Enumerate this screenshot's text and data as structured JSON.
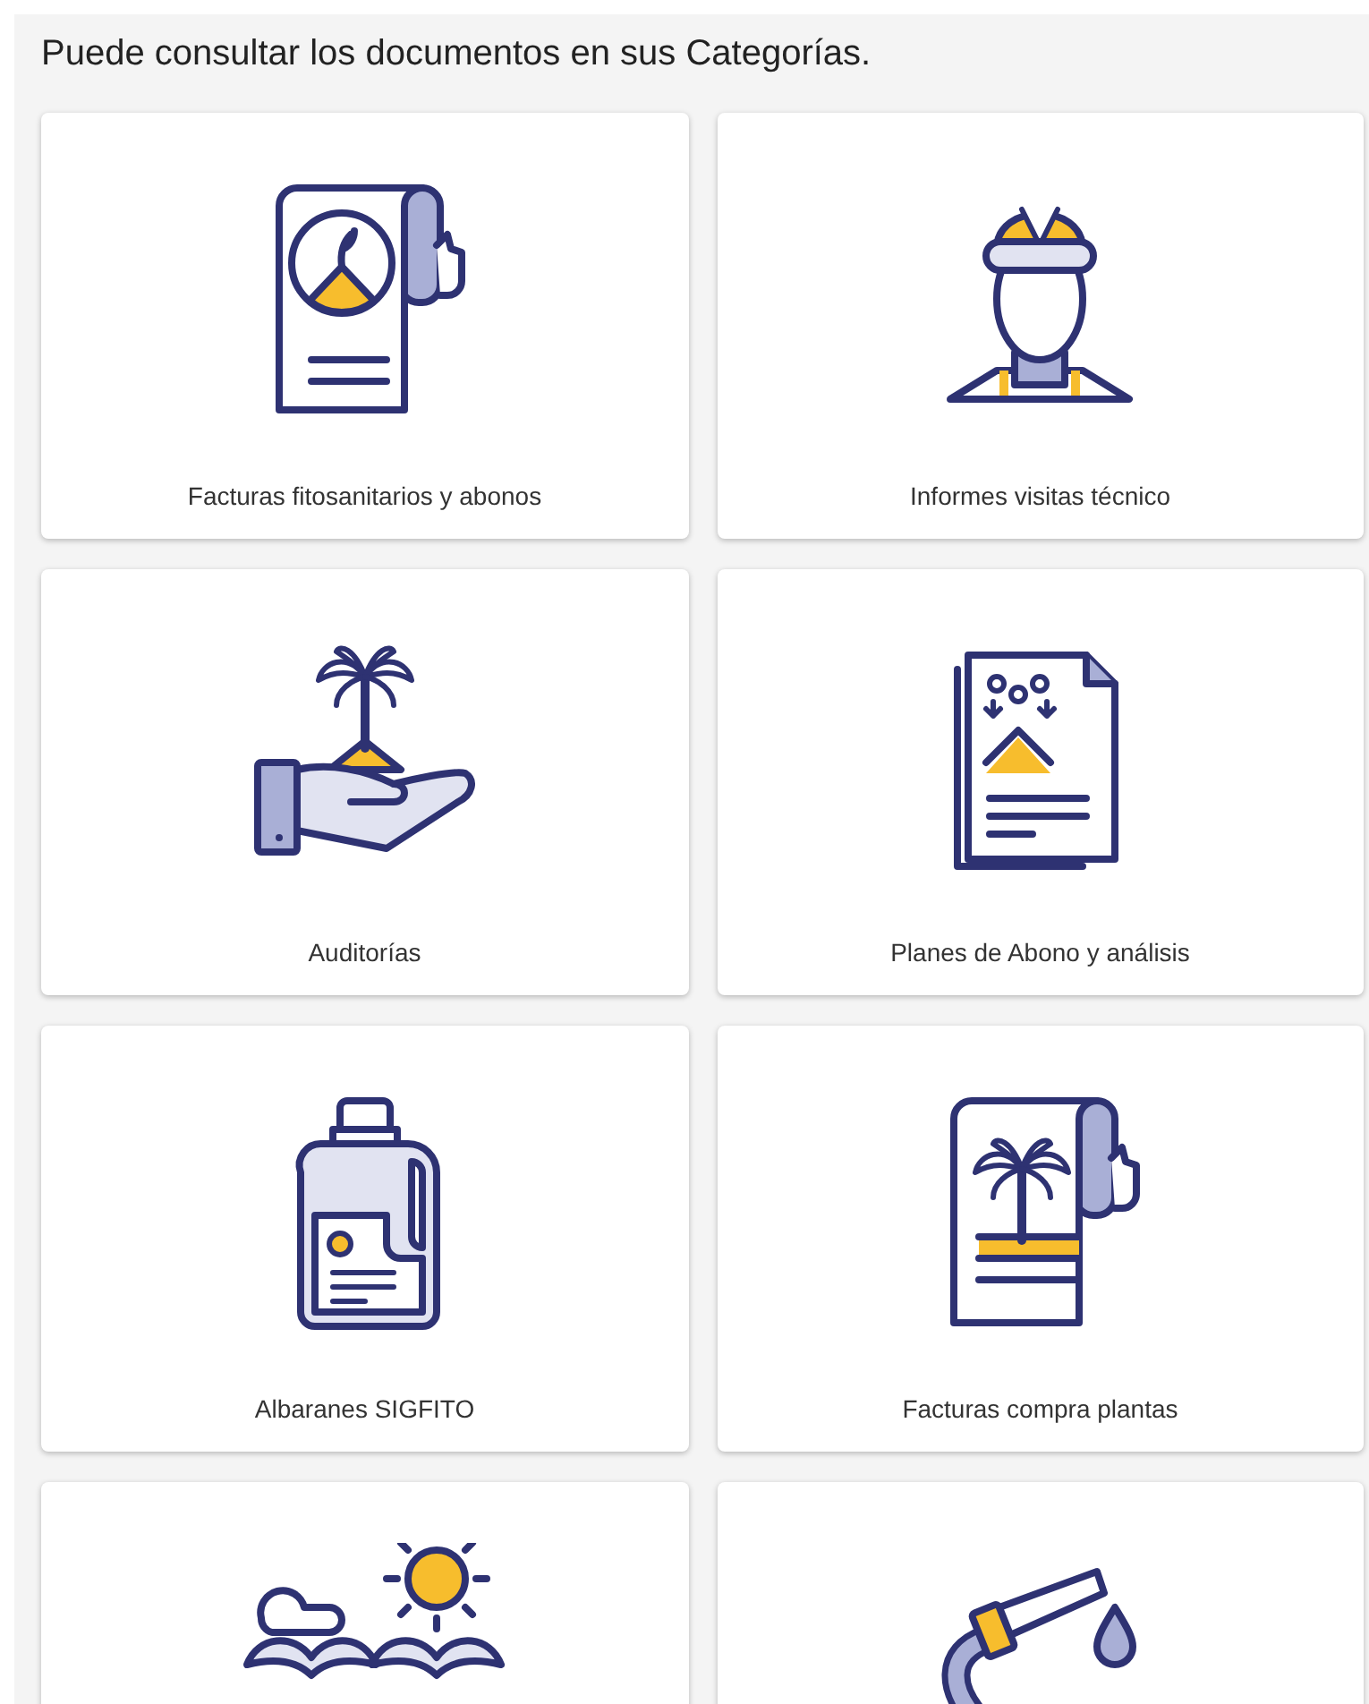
{
  "heading": "Puede consultar los documentos en sus Categorías.",
  "categories": [
    {
      "kind": "invoice-sprout",
      "label": "Facturas fitosanitarios y abonos"
    },
    {
      "kind": "worker",
      "label": "Informes visitas técnico"
    },
    {
      "kind": "hand-palm",
      "label": "Auditorías"
    },
    {
      "kind": "report",
      "label": "Planes de Abono y análisis"
    },
    {
      "kind": "bottle",
      "label": "Albaranes SIGFITO"
    },
    {
      "kind": "invoice-palm",
      "label": "Facturas compra plantas"
    },
    {
      "kind": "weather"
    },
    {
      "kind": "hose"
    }
  ]
}
